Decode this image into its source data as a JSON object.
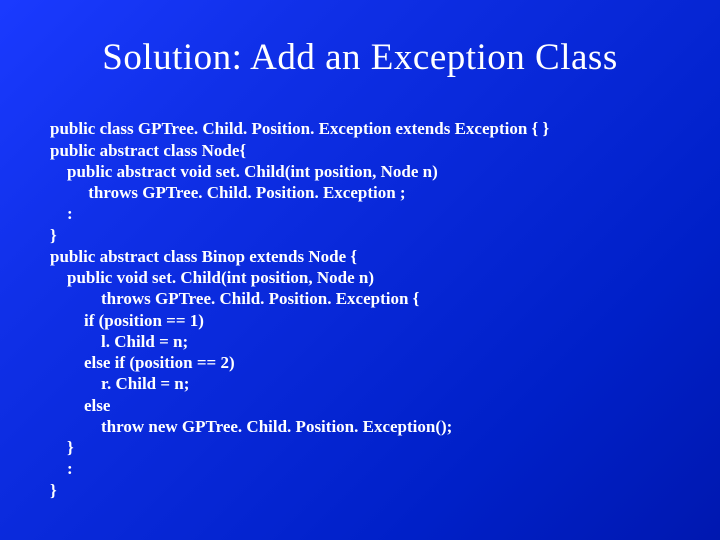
{
  "slide": {
    "title": "Solution: Add an Exception Class",
    "code_lines": [
      "public class GPTree. Child. Position. Exception extends Exception { }",
      "public abstract class Node{",
      "    public abstract void set. Child(int position, Node n)",
      "         throws GPTree. Child. Position. Exception ;",
      "    :",
      "}",
      "public abstract class Binop extends Node {",
      "    public void set. Child(int position, Node n)",
      "            throws GPTree. Child. Position. Exception {",
      "        if (position == 1)",
      "            l. Child = n;",
      "        else if (position == 2)",
      "            r. Child = n;",
      "        else",
      "            throw new GPTree. Child. Position. Exception();",
      "    }",
      "    :",
      "}"
    ]
  }
}
